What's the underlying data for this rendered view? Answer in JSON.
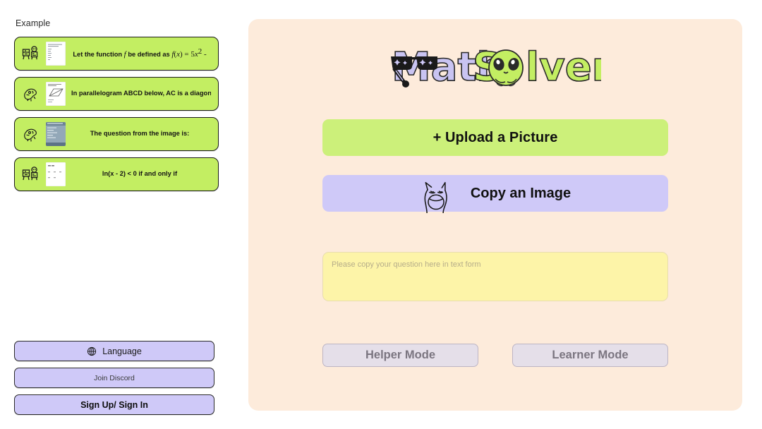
{
  "sidebar": {
    "section_label": "Example",
    "examples": [
      {
        "icon": "teacher-blackboard-icon",
        "thumb": "document-thumbnail",
        "text_html": "Let the function <span class=\"mathi\">f</span> be defined as <span class=\"mathi\">f</span><span class=\"mathroman\">(</span><span class=\"mathi\">x</span><span class=\"mathroman\">) = 5</span><span class=\"mathi\">x</span><sup class=\"mathroman\">2</sup><span class=\"mathroman\"> -</span>",
        "text_plain": "Let the function f be defined as f(x) = 5x² -"
      },
      {
        "icon": "dino-scribble-icon",
        "thumb": "parallelogram-thumbnail",
        "text_html": "In parallelogram ABCD below, AC is a diagonal",
        "text_plain": "In parallelogram ABCD below, AC is a diagonal"
      },
      {
        "icon": "dino-scribble-icon",
        "thumb": "blue-screenshot-thumbnail",
        "text_html": "The question from the image is:",
        "text_plain": "The question from the image is:"
      },
      {
        "icon": "teacher-blackboard-icon",
        "thumb": "table-thumbnail",
        "text_html": "ln(x - 2) &lt; 0 if and only if",
        "text_plain": "ln(x - 2) < 0 if and only if"
      }
    ],
    "buttons": [
      {
        "label": "Language",
        "icon": "globe-icon",
        "style": "normal"
      },
      {
        "label": "Join Discord",
        "icon": "",
        "style": "small"
      },
      {
        "label": "Sign Up/ Sign In",
        "icon": "",
        "style": "bold"
      }
    ]
  },
  "main": {
    "logo": {
      "text_part1": "Math",
      "text_part2": "S",
      "text_part3": "lver",
      "full_text": "MathSolver",
      "overlay_icons": [
        "sunglasses-icon",
        "alien-face-icon"
      ],
      "color_part1": "#c9c4f2",
      "color_part2": "#c3ee62"
    },
    "upload_button": {
      "label": "+ Upload a Picture",
      "color": "#ccf07a"
    },
    "copy_button": {
      "label": "Copy an Image",
      "icon": "screaming-cat-icon",
      "color": "#cfc9f8"
    },
    "question_input": {
      "placeholder": "Please copy your question here in text form",
      "value": "",
      "color": "#fdf4a8"
    },
    "mode_buttons": [
      {
        "label": "Helper Mode"
      },
      {
        "label": "Learner Mode"
      }
    ],
    "panel_color": "#fdebdb"
  }
}
